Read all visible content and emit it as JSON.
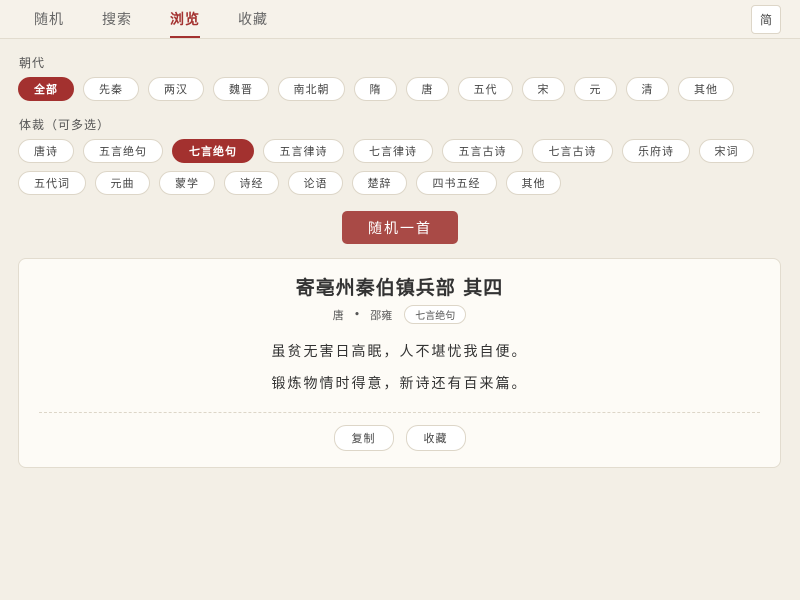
{
  "nav": {
    "tabs": [
      {
        "label": "随机"
      },
      {
        "label": "搜索"
      },
      {
        "label": "浏览"
      },
      {
        "label": "收藏"
      }
    ],
    "active_tab": "浏览",
    "lang_toggle": "简"
  },
  "dynasty": {
    "label": "朝代",
    "options": [
      "全部",
      "先秦",
      "两汉",
      "魏晋",
      "南北朝",
      "隋",
      "唐",
      "五代",
      "宋",
      "元",
      "清",
      "其他"
    ],
    "selected": "全部"
  },
  "genre": {
    "label": "体裁（可多选）",
    "options": [
      "唐诗",
      "五言绝句",
      "七言绝句",
      "五言律诗",
      "七言律诗",
      "五言古诗",
      "七言古诗",
      "乐府诗",
      "宋词",
      "五代词",
      "元曲",
      "蒙学",
      "诗经",
      "论语",
      "楚辞",
      "四书五经",
      "其他"
    ],
    "selected": "七言绝句"
  },
  "random_button": "随机一首",
  "poem": {
    "title": "寄亳州秦伯镇兵部 其四",
    "dynasty": "唐",
    "separator": "•",
    "author": "邵雍",
    "form": "七言绝句",
    "lines": [
      "虽贫无害日高眠，人不堪忧我自便。",
      "锻炼物情时得意，新诗还有百来篇。"
    ]
  },
  "actions": {
    "copy": "复制",
    "favorite": "收藏"
  }
}
